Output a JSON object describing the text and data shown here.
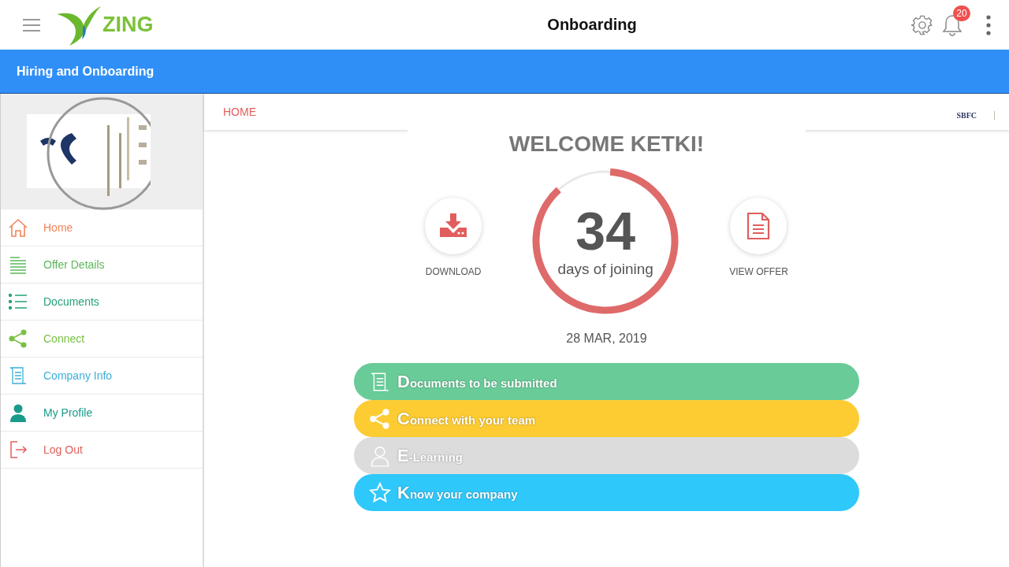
{
  "app_bar": {
    "brand": "ZING",
    "title": "Onboarding",
    "notification_count": "20"
  },
  "section_bar": {
    "title": "Hiring and Onboarding"
  },
  "sidebar": {
    "items": [
      {
        "label": "Home",
        "kind": "home",
        "color": "#f0845a"
      },
      {
        "label": "Offer Details",
        "kind": "lines",
        "color": "#5cb85c"
      },
      {
        "label": "Documents",
        "kind": "list",
        "color": "#26a17c"
      },
      {
        "label": "Connect",
        "kind": "share",
        "color": "#7ac143"
      },
      {
        "label": "Company Info",
        "kind": "scroll",
        "color": "#3bb0d8"
      },
      {
        "label": "My Profile",
        "kind": "person",
        "color": "#1a9a8a"
      },
      {
        "label": "Log Out",
        "kind": "logout",
        "color": "#e0605e"
      }
    ]
  },
  "breadcrumb": "HOME",
  "company_badge": "SBFC",
  "welcome": "WELCOME KETKI!",
  "countdown": {
    "number": "34",
    "caption": "days of joining",
    "level": 0.87,
    "date": "28 MAR, 2019"
  },
  "actions": [
    {
      "label": "DOWNLOAD",
      "kind": "download"
    },
    {
      "label": "VIEW OFFER",
      "kind": "document"
    }
  ],
  "tiles": [
    {
      "label": "Documents to be submitted",
      "kind": "scroll",
      "color": "#68cb98"
    },
    {
      "label": "Connect with your team",
      "kind": "share",
      "color": "#fdcb32"
    },
    {
      "label": "E-Learning",
      "kind": "person",
      "color": "#dcdcdc"
    },
    {
      "label": "Know your company",
      "kind": "star",
      "color": "#2fc8fb"
    }
  ]
}
